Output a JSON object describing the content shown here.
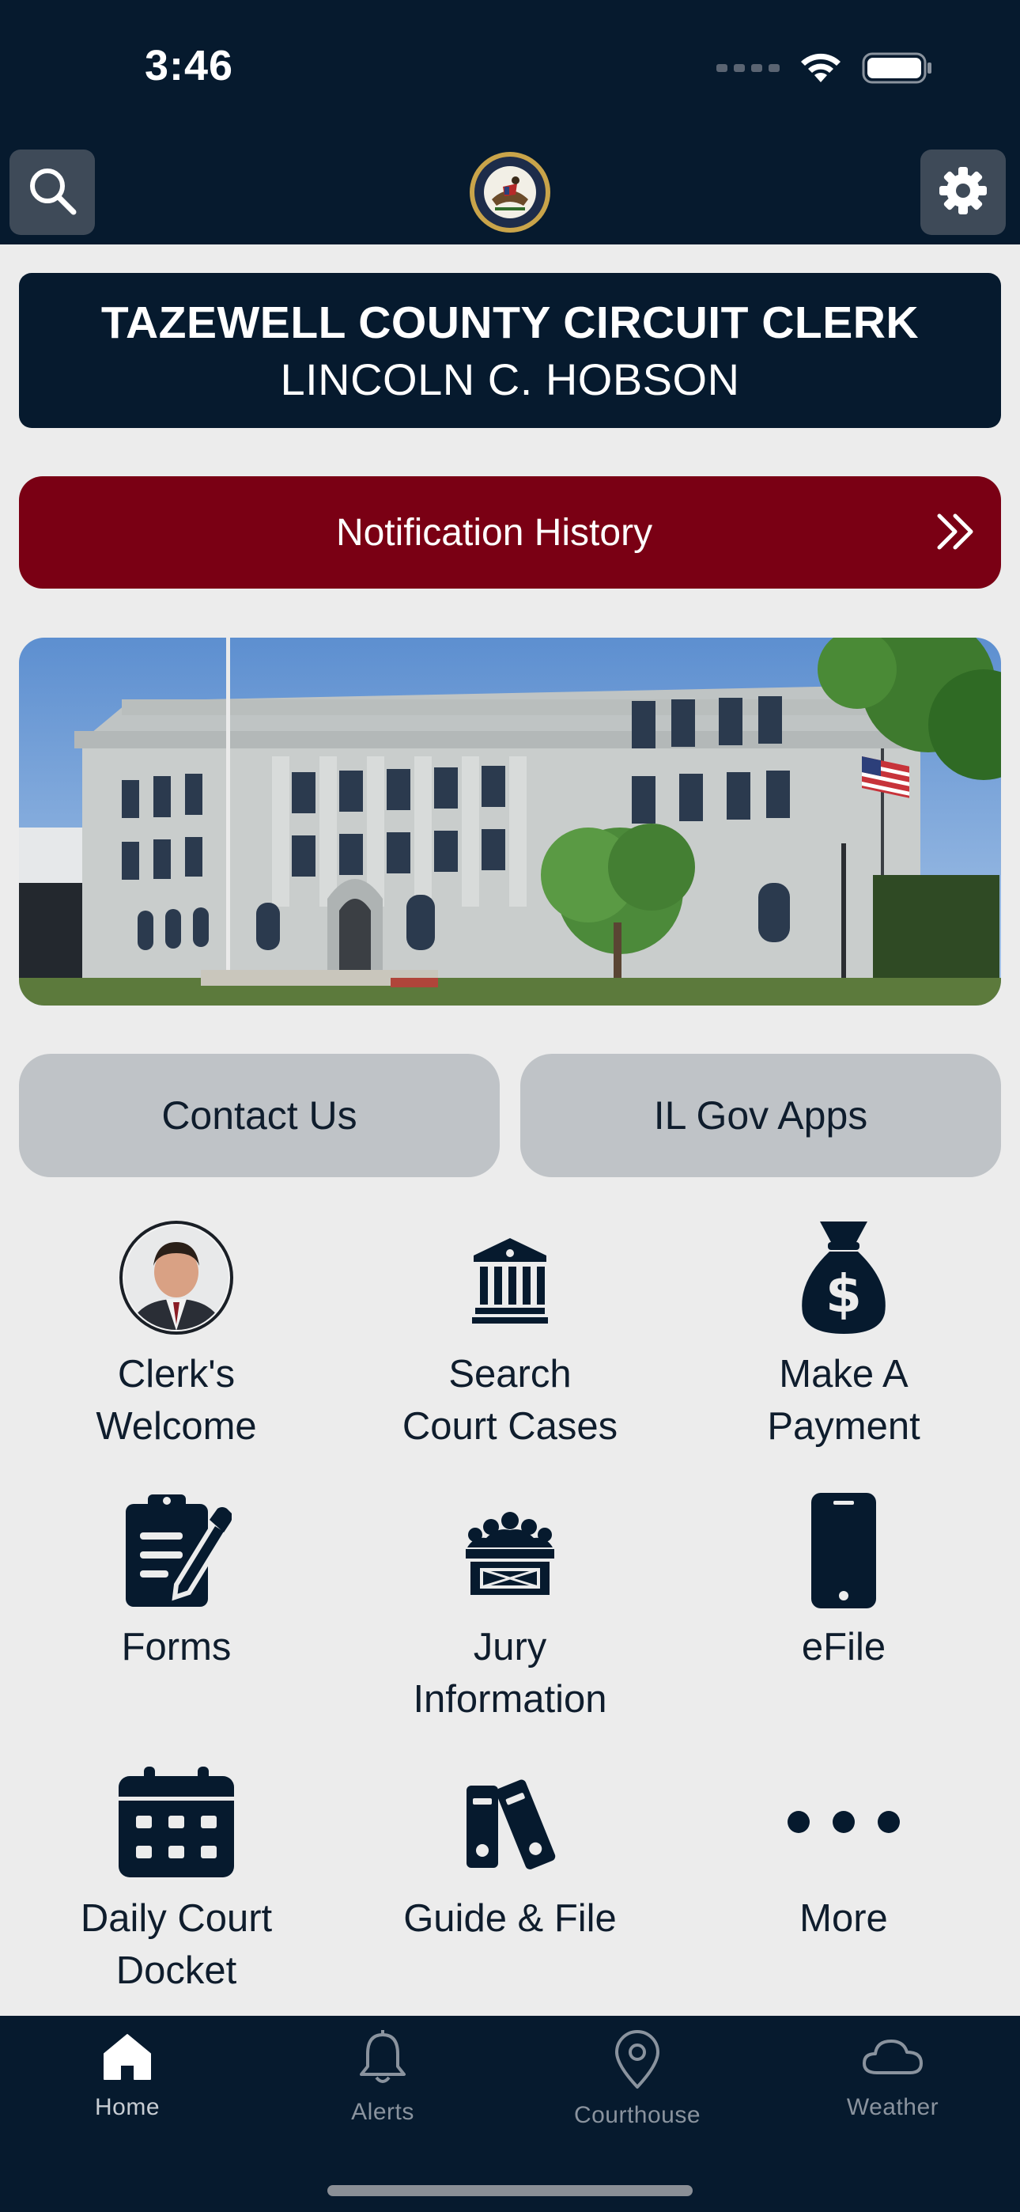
{
  "status_bar": {
    "time": "3:46"
  },
  "top_bar": {
    "search_icon": "search-icon",
    "seal_icon": "state-seal-icon",
    "settings_icon": "gear-icon"
  },
  "header": {
    "title": "TAZEWELL COUNTY CIRCUIT CLERK",
    "subtitle": "LINCOLN C. HOBSON"
  },
  "notification": {
    "label": "Notification History",
    "icon": "double-chevron-right-icon"
  },
  "quick_links": [
    {
      "label": "Contact Us"
    },
    {
      "label": "IL Gov Apps"
    }
  ],
  "grid": [
    {
      "label": "Clerk's\nWelcome",
      "icon": "clerk-avatar"
    },
    {
      "label": "Search\nCourt Cases",
      "icon": "courthouse-icon"
    },
    {
      "label": "Make A\nPayment",
      "icon": "money-bag-icon"
    },
    {
      "label": "Forms",
      "icon": "clipboard-edit-icon"
    },
    {
      "label": "Jury\nInformation",
      "icon": "jury-box-icon"
    },
    {
      "label": "eFile",
      "icon": "phone-icon"
    },
    {
      "label": "Daily Court\nDocket",
      "icon": "calendar-icon"
    },
    {
      "label": "Guide & File",
      "icon": "binders-icon"
    },
    {
      "label": "More",
      "icon": "more-dots-icon"
    }
  ],
  "tabs": [
    {
      "label": "Home",
      "icon": "home-icon",
      "active": true
    },
    {
      "label": "Alerts",
      "icon": "bell-icon"
    },
    {
      "label": "Courthouse",
      "icon": "location-pin-icon"
    },
    {
      "label": "Weather",
      "icon": "cloud-icon"
    }
  ],
  "colors": {
    "navy": "#061a2e",
    "burgundy": "#7a0014",
    "pill_gray": "#bfc3c7",
    "background": "#ececec"
  }
}
